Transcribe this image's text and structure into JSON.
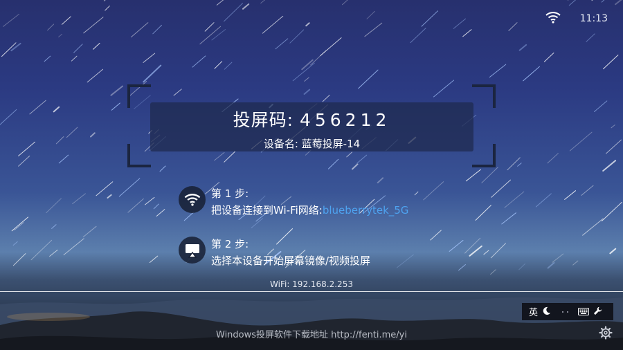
{
  "status_bar": {
    "time": "11:13",
    "wifi_icon": "wifi-icon"
  },
  "pairing": {
    "code_label": "投屏码:",
    "code": "456212",
    "device_label": "设备名:",
    "device_name": "蓝莓投屏-14"
  },
  "steps": [
    {
      "title": "第 1 步:",
      "text": "把设备连接到Wi-Fi网络:",
      "highlight": "blueberrytek_5G",
      "icon": "wifi-icon"
    },
    {
      "title": "第 2 步:",
      "text": "选择本设备开始屏幕镜像/视频投屏",
      "icon": "airplay-icon"
    }
  ],
  "network": {
    "wifi_ip": "WiFi: 192.168.2.253"
  },
  "ime": {
    "lang": "英",
    "icons": [
      "moon-icon",
      "keyboard-icon",
      "wrench-icon"
    ]
  },
  "footer": {
    "text": "Windows投屏软件下载地址 http://fenti.me/yi"
  },
  "colors": {
    "accent": "#4ea3f0",
    "panel": "#1e2a4e",
    "sky_top": "#27306e",
    "horizon": "#5c7fad"
  }
}
